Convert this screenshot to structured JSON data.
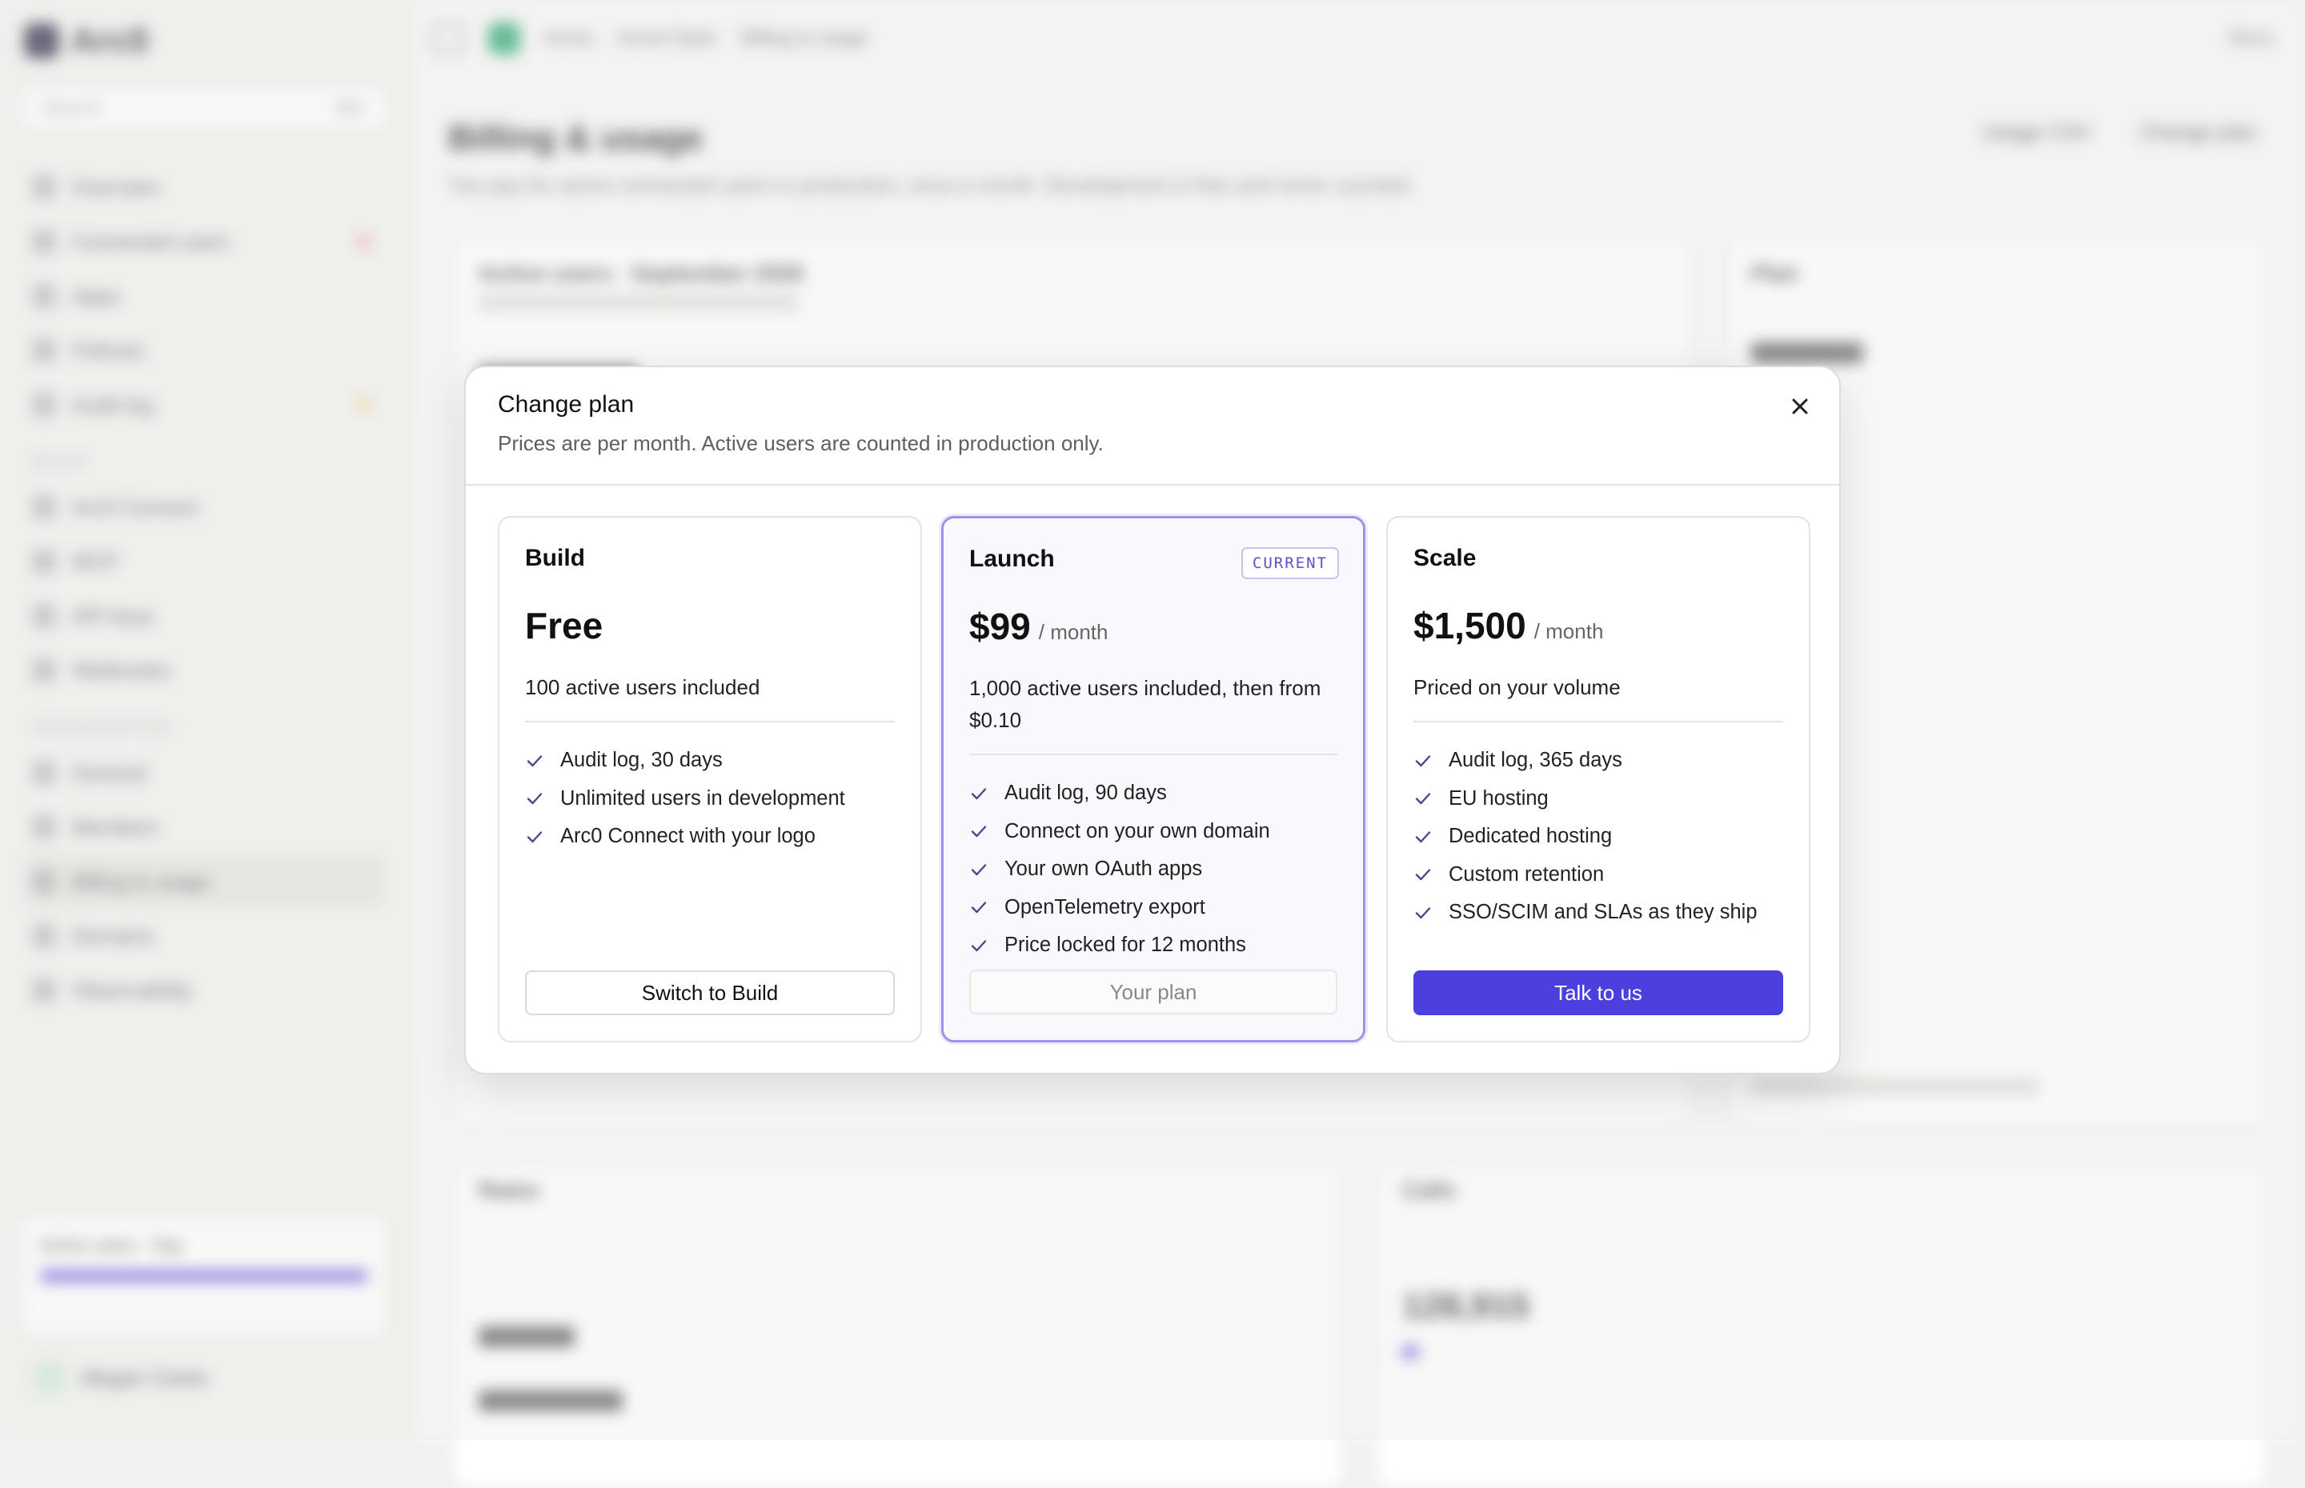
{
  "background": {
    "app_name": "Arc0",
    "search_placeholder": "Search",
    "search_shortcut": "⌘K",
    "nav": [
      "Overview",
      "Connected users",
      "Apps",
      "Policies",
      "Audit log"
    ],
    "build_section": "BUILD",
    "build_nav": [
      "Arc0 Connect",
      "MCP",
      "API keys",
      "Webhooks"
    ],
    "org_section": "ORGANIZATION",
    "org_nav": [
      "General",
      "Members",
      "Billing & usage",
      "Domains",
      "Observability"
    ],
    "breadcrumb": [
      "Acme",
      "Acme Dash",
      "Billing & usage"
    ],
    "top_right": "Docs",
    "page_title": "Billing & usage",
    "page_subtitle": "You pay for active connected users in production, once a month. Development is free and never counted.",
    "btn_usage_csv": "Usage CSV",
    "btn_change_plan": "Change plan",
    "usage_card_title": "Active users · Sep",
    "user_name": "Megan Carter",
    "active_users_title": "Active users · September 2026",
    "plan_card_title": "Plan",
    "rates_title": "Rates",
    "calls_title": "Calls",
    "calls_value": "128,915"
  },
  "modal": {
    "title": "Change plan",
    "subtitle": "Prices are per month. Active users are counted in production only.",
    "close_icon": "close-icon",
    "plans": [
      {
        "name": "Build",
        "price": "Free",
        "period": "",
        "description": "100 active users included",
        "features": [
          "Audit log, 30 days",
          "Unlimited users in development",
          "Arc0 Connect with your logo"
        ],
        "button": "Switch to Build",
        "badge": ""
      },
      {
        "name": "Launch",
        "price": "$99",
        "period": "/ month",
        "description": "1,000 active users included, then from $0.10",
        "features": [
          "Audit log, 90 days",
          "Connect on your own domain",
          "Your own OAuth apps",
          "OpenTelemetry export",
          "Price locked for 12 months"
        ],
        "button": "Your plan",
        "badge": "CURRENT"
      },
      {
        "name": "Scale",
        "price": "$1,500",
        "period": "/ month",
        "description": "Priced on your volume",
        "features": [
          "Audit log, 365 days",
          "EU hosting",
          "Dedicated hosting",
          "Custom retention",
          "SSO/SCIM and SLAs as they ship"
        ],
        "button": "Talk to us",
        "badge": ""
      }
    ]
  },
  "colors": {
    "accent": "#4b40dd",
    "current_border": "#9b93ea",
    "check": "#4a4a8a"
  }
}
